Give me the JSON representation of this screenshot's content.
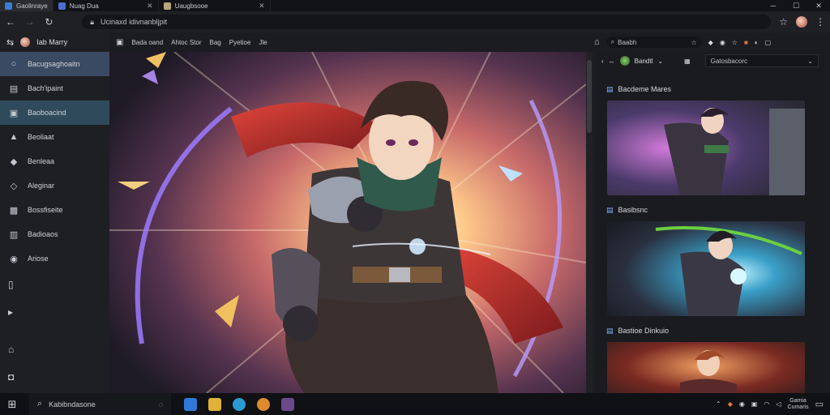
{
  "tabs": [
    {
      "label": "Gaolinraye",
      "color": "#3a7bd5"
    },
    {
      "label": "Nuag Dua",
      "color": "#4a6fd1"
    },
    {
      "label": "Uaugbsooe",
      "color": "#b9a77a"
    }
  ],
  "window": {
    "min": "─",
    "max": "☐",
    "close": "✕"
  },
  "address": {
    "url": "Ucinaxd idivnanbljpit"
  },
  "sidebar": {
    "profile_name": "Iab Marry",
    "items": [
      {
        "label": "Bacugsaghoaitn",
        "icon": "○"
      },
      {
        "label": "Bach'ipaint",
        "icon": "▤"
      },
      {
        "label": "Baoboacind",
        "icon": "▣"
      },
      {
        "label": "Beoliaat",
        "icon": "▲"
      },
      {
        "label": "Benleaa",
        "icon": "◆"
      },
      {
        "label": "Aleginar",
        "icon": "◇"
      },
      {
        "label": "Bossfiseite",
        "icon": "▩"
      },
      {
        "label": "Badioaos",
        "icon": "▥"
      },
      {
        "label": "Ariose",
        "icon": "◉"
      }
    ],
    "extra_icons": [
      "▯",
      "▸",
      "⌂",
      "◘"
    ]
  },
  "toolbar": {
    "items": [
      "Bada oand",
      "Ahtoc Stor",
      "Bag",
      "Pyetioe",
      "Jle"
    ]
  },
  "rtool": {
    "search_text": "Baabh"
  },
  "rpanel": {
    "user": "Bandtl",
    "dropdown_label": "Gatosbacorc",
    "cards": [
      {
        "title": "Bacdeme Mares"
      },
      {
        "title": "Basibsnc"
      },
      {
        "title": "Bastioe Dinkuio"
      }
    ]
  },
  "taskbar": {
    "search_text": "Kabibndasone",
    "clock_time": "Gamia",
    "clock_date": "Cumaris"
  }
}
